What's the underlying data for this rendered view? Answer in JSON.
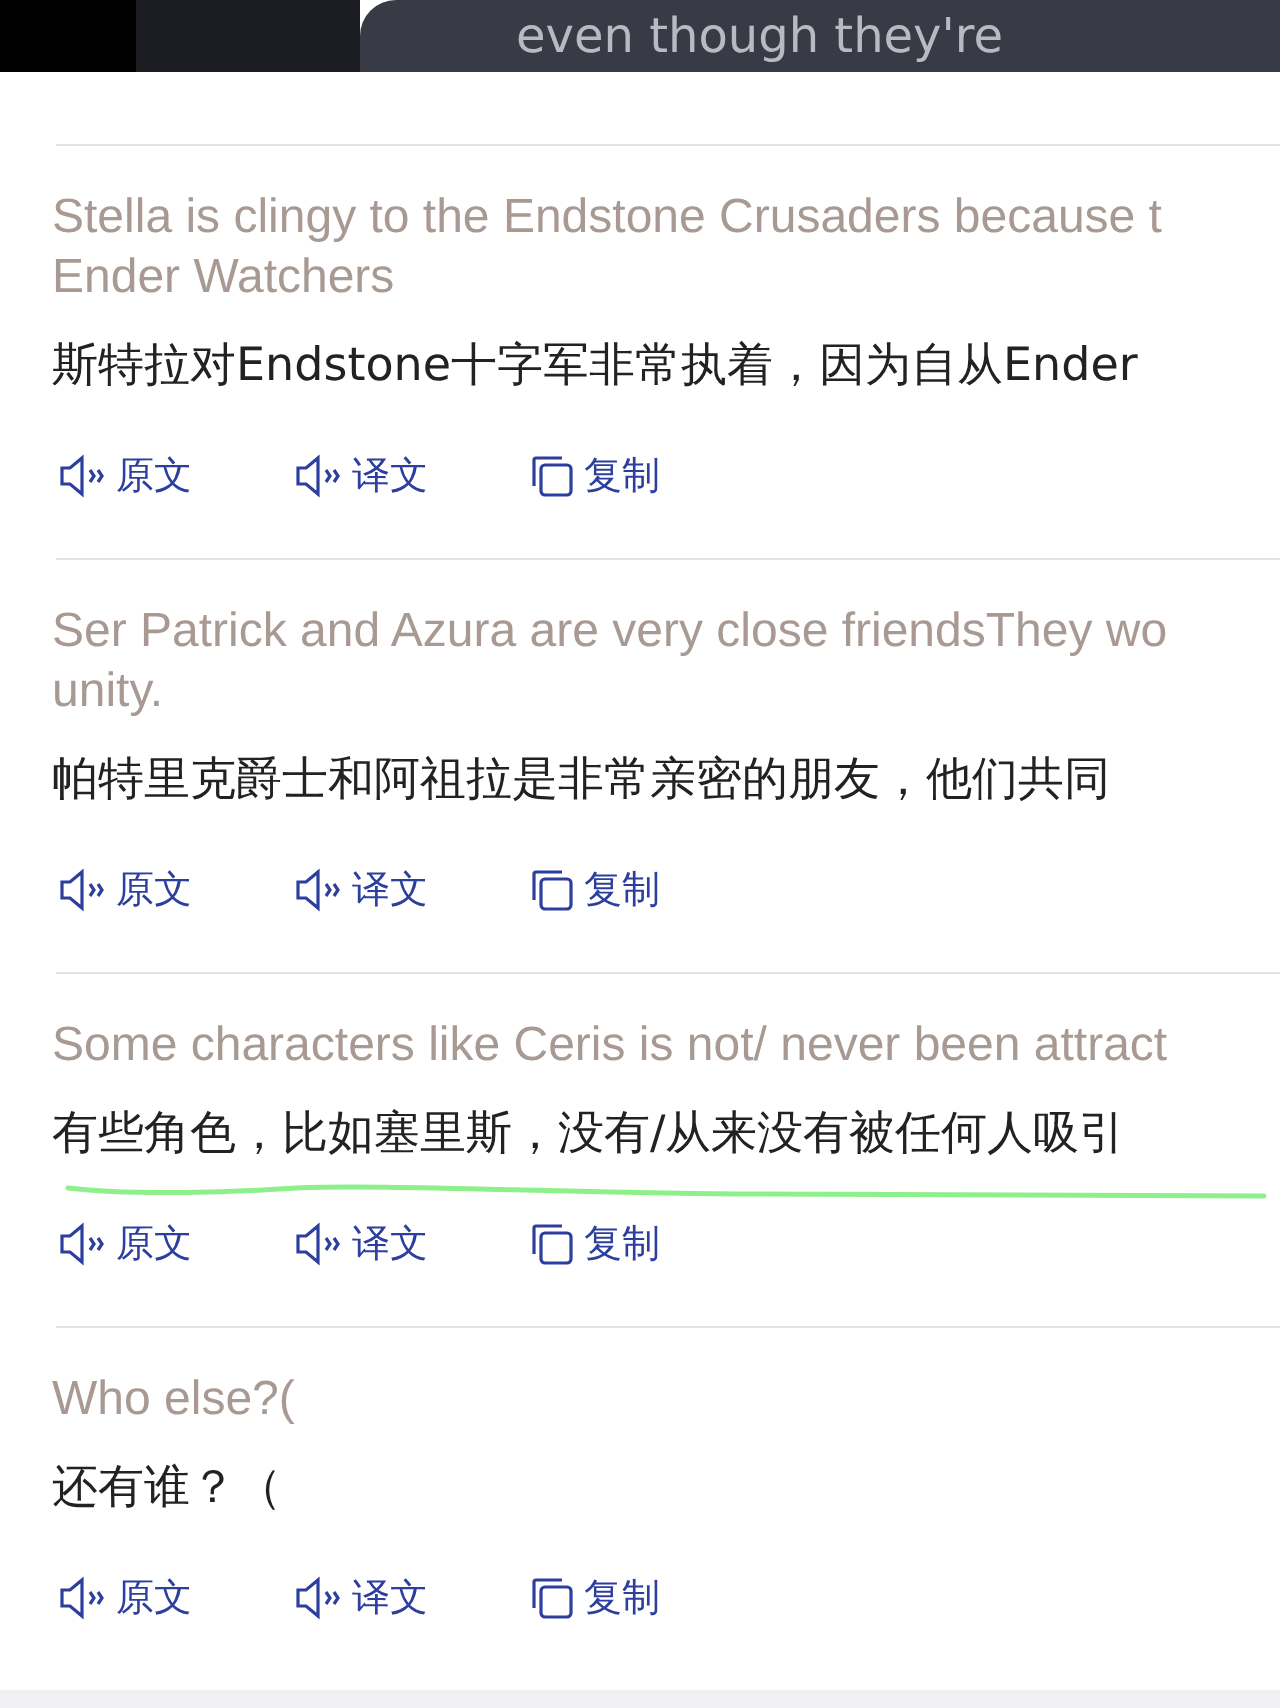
{
  "overlay": {
    "caption": "even though they're"
  },
  "items": [
    {
      "source_lines": [
        "Stella is clingy to the Endstone Crusaders because  t",
        "Ender Watchers"
      ],
      "translation": "斯特拉对Endstone十字军非常执着，因为自从Ender",
      "underlined": false,
      "actions": [
        {
          "kind": "speak",
          "label": "原文"
        },
        {
          "kind": "speak",
          "label": "译文"
        },
        {
          "kind": "copy",
          "label": "复制"
        }
      ]
    },
    {
      "source_lines": [
        "Ser Patrick and Azura are very close friendsThey  wo",
        "unity."
      ],
      "translation": "帕特里克爵士和阿祖拉是非常亲密的朋友，他们共同",
      "underlined": false,
      "actions": [
        {
          "kind": "speak",
          "label": "原文"
        },
        {
          "kind": "speak",
          "label": "译文"
        },
        {
          "kind": "copy",
          "label": "复制"
        }
      ]
    },
    {
      "source_lines": [
        "Some characters like Ceris is not/ never been  attract"
      ],
      "translation": "有些角色，比如塞里斯，没有/从来没有被任何人吸引",
      "underlined": true,
      "actions": [
        {
          "kind": "speak",
          "label": "原文"
        },
        {
          "kind": "speak",
          "label": "译文"
        },
        {
          "kind": "copy",
          "label": "复制"
        }
      ]
    },
    {
      "source_lines": [
        "Who else?("
      ],
      "translation": "还有谁？（",
      "underlined": false,
      "actions": [
        {
          "kind": "speak",
          "label": "原文"
        },
        {
          "kind": "speak",
          "label": "译文"
        },
        {
          "kind": "copy",
          "label": "复制"
        }
      ]
    }
  ]
}
